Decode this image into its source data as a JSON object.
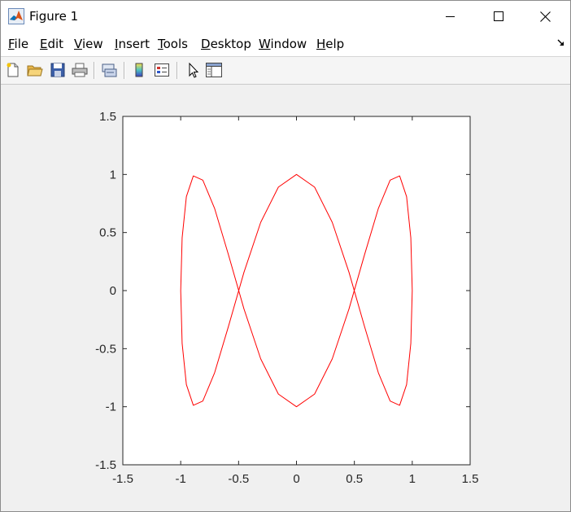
{
  "window": {
    "title": "Figure 1",
    "controls": [
      "minimize",
      "maximize",
      "close"
    ]
  },
  "menu": {
    "items": [
      {
        "label": "File",
        "mnemonic": "F",
        "rest": "ile"
      },
      {
        "label": "Edit",
        "mnemonic": "E",
        "rest": "dit"
      },
      {
        "label": "View",
        "mnemonic": "V",
        "rest": "iew"
      },
      {
        "label": "Insert",
        "mnemonic": "I",
        "rest": "nsert"
      },
      {
        "label": "Tools",
        "mnemonic": "T",
        "rest": "ools"
      },
      {
        "label": "Desktop",
        "mnemonic": "D",
        "rest": "esktop"
      },
      {
        "label": "Window",
        "mnemonic": "W",
        "rest": "indow"
      },
      {
        "label": "Help",
        "mnemonic": "H",
        "rest": "elp"
      }
    ]
  },
  "toolbar": {
    "buttons": [
      "new-figure-icon",
      "open-file-icon",
      "save-icon",
      "print-icon",
      "link-plot-icon",
      "insert-colorbar-icon",
      "insert-legend-icon",
      "edit-plot-icon",
      "property-inspector-icon"
    ]
  },
  "colors": {
    "line": "#ff0000",
    "axes_bg": "#ffffff",
    "figure_bg": "#f0f0f0"
  },
  "chart_data": {
    "type": "line",
    "title": "",
    "xlabel": "",
    "ylabel": "",
    "xlim": [
      -1.5,
      1.5
    ],
    "ylim": [
      -1.5,
      1.5
    ],
    "xticks": [
      "-1.5",
      "-1",
      "-0.5",
      "0",
      "0.5",
      "1",
      "1.5"
    ],
    "yticks": [
      "1.5",
      "1",
      "0.5",
      "0",
      "-0.5",
      "-1",
      "-1.5"
    ],
    "grid": false,
    "box": true,
    "series": [
      {
        "color": "#ff0000",
        "x": [
          1.0,
          0.9877,
          0.9511,
          0.891,
          0.809,
          0.7071,
          0.5878,
          0.454,
          0.309,
          0.1564,
          0.0,
          -0.1564,
          -0.309,
          -0.454,
          -0.5878,
          -0.7071,
          -0.809,
          -0.891,
          -0.9511,
          -0.9877,
          -1.0,
          -0.9877,
          -0.9511,
          -0.891,
          -0.809,
          -0.7071,
          -0.5878,
          -0.454,
          -0.309,
          -0.1564,
          0.0,
          0.1564,
          0.309,
          0.454,
          0.5878,
          0.7071,
          0.809,
          0.891,
          0.9511,
          0.9877,
          1.0
        ],
        "y": [
          0.0,
          0.454,
          0.809,
          0.9877,
          0.9511,
          0.7071,
          0.309,
          -0.1564,
          -0.5878,
          -0.891,
          -1.0,
          -0.891,
          -0.5878,
          -0.1564,
          0.309,
          0.7071,
          0.9511,
          0.9877,
          0.809,
          0.454,
          0.0,
          -0.454,
          -0.809,
          -0.9877,
          -0.9511,
          -0.7071,
          -0.309,
          0.1564,
          0.5878,
          0.891,
          1.0,
          0.891,
          0.5878,
          0.1564,
          -0.309,
          -0.7071,
          -0.9511,
          -0.9877,
          -0.809,
          -0.454,
          0.0
        ]
      }
    ]
  }
}
